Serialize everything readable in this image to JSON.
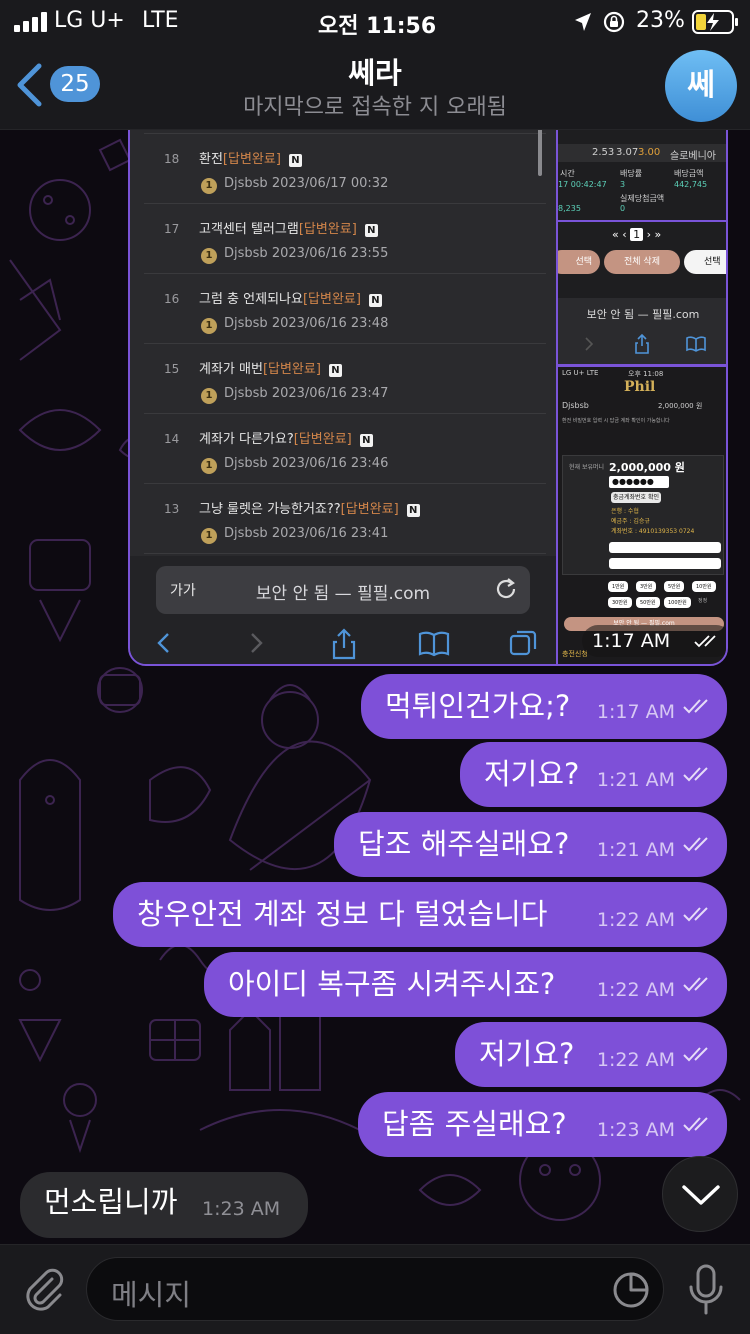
{
  "status": {
    "carrier": "LG U+",
    "network": "LTE",
    "time": "오전 11:56",
    "battery": "23%",
    "icons": [
      "signal-icon",
      "location-icon",
      "orientation-lock-icon",
      "battery-charging-icon"
    ]
  },
  "header": {
    "back_count": "25",
    "title": "쎄라",
    "subtitle": "마지막으로 접속한 지 오래됨",
    "avatar_letter": "쎄",
    "avatar_color": "#4f94d8"
  },
  "media": {
    "time": "1:17 AM",
    "board": {
      "rows": [
        {
          "num": "18",
          "title": "환전",
          "tag": "[답변완료]",
          "badge": "N",
          "coin": "1",
          "user": "Djsbsb",
          "date": "2023/06/17 00:32"
        },
        {
          "num": "17",
          "title": "고객센터 텔러그램",
          "tag": "[답변완료]",
          "badge": "N",
          "coin": "1",
          "user": "Djsbsb",
          "date": "2023/06/16 23:55"
        },
        {
          "num": "16",
          "title": "그럼 충 언제되나요",
          "tag": "[답변완료]",
          "badge": "N",
          "coin": "1",
          "user": "Djsbsb",
          "date": "2023/06/16 23:48"
        },
        {
          "num": "15",
          "title": "계좌가 매번",
          "tag": "[답변완료]",
          "badge": "N",
          "coin": "1",
          "user": "Djsbsb",
          "date": "2023/06/16 23:47"
        },
        {
          "num": "14",
          "title": "계좌가 다른가요?",
          "tag": "[답변완료]",
          "badge": "N",
          "coin": "1",
          "user": "Djsbsb",
          "date": "2023/06/16 23:46"
        },
        {
          "num": "13",
          "title": "그냥 룰렛은 가능한거죠??",
          "tag": "[답변완료]",
          "badge": "N",
          "coin": "1",
          "user": "Djsbsb",
          "date": "2023/06/16 23:41"
        }
      ],
      "aa": "가가",
      "url": "보안 안 됨 — 필필.com"
    },
    "top_right": {
      "odds": [
        "2.53",
        "3.07",
        "3.00",
        "슬로베니아"
      ],
      "labels": [
        "시간",
        "배당률",
        "배당금액"
      ],
      "values": [
        "17 00:42:47",
        "3",
        "442,745"
      ],
      "label2": "실제당첨금액",
      "amount": "8,235",
      "value2": "0",
      "page": "1",
      "btn_select": "선택",
      "btn_delete": "전체 삭제",
      "btn_select2": "선택",
      "url": "보안 안 됨 — 필필.com"
    },
    "bottom_right": {
      "status": "LG U+ LTE",
      "time": "오후 11:08",
      "logo": "Phil",
      "user": "Djsbsb",
      "balance": "2,000,000 원",
      "notice": "환전 비밀번호 입력 시 답금 계좌 확인이 가능합니다",
      "current_label": "현재 보유머니",
      "current_value": "2,000,000 원",
      "password": "●●●●●●",
      "account_btn": "충금계좌번호 확인",
      "bank": "은행 : 수협",
      "holder": "예금주 : 김승규",
      "account": "계좌번호 : 4910139353 0724",
      "amounts": [
        "1만원",
        "3만원",
        "5만원",
        "10만원",
        "30만원",
        "50만원",
        "100만원",
        "정정"
      ],
      "footer": "보안 안 됨 — 필필.com",
      "submit": "충전신청"
    }
  },
  "messages": [
    {
      "text": "먹튀인건가요;?",
      "time": "1:17 AM"
    },
    {
      "text": "저기요?",
      "time": "1:21 AM"
    },
    {
      "text": "답조 해주실래요?",
      "time": "1:21 AM"
    },
    {
      "text": "창우안전 계좌 정보 다 털었습니다",
      "time": "1:22 AM"
    },
    {
      "text": "아이디 복구좀 시켜주시죠?",
      "time": "1:22 AM"
    },
    {
      "text": "저기요?",
      "time": "1:22 AM"
    },
    {
      "text": "답좀 주실래요?",
      "time": "1:23 AM"
    }
  ],
  "incoming": {
    "text": "먼소립니까",
    "time": "1:23 AM"
  },
  "input": {
    "placeholder": "메시지"
  },
  "colors": {
    "bubble": "#7e50d8",
    "accent": "#4f94d8",
    "background": "#0c0a10"
  }
}
